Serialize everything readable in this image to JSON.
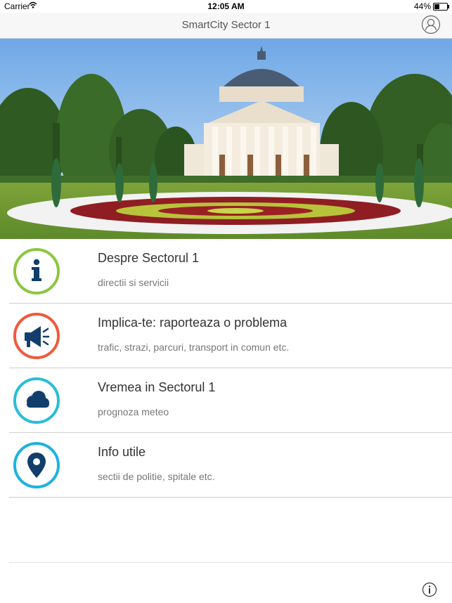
{
  "status_bar": {
    "carrier": "Carrier",
    "time": "12:05 AM",
    "battery_percent": "44%",
    "battery_level": 0.44
  },
  "nav": {
    "title": "SmartCity Sector 1",
    "right_icon": "user-profile-icon"
  },
  "hero": {
    "image": "Romanian Athenaeum with flower garden"
  },
  "menu": {
    "items": [
      {
        "title": "Despre Sectorul 1",
        "subtitle": "directii si servicii",
        "icon": "info-icon",
        "ring_color": "#8dc63f"
      },
      {
        "title": "Implica-te: raporteaza o problema",
        "subtitle": "trafic, strazi, parcuri, transport in comun etc.",
        "icon": "megaphone-icon",
        "ring_color": "#ef5a3c"
      },
      {
        "title": "Vremea in Sectorul 1",
        "subtitle": "prognoza meteo",
        "icon": "cloud-icon",
        "ring_color": "#2bbcd9"
      },
      {
        "title": "Info utile",
        "subtitle": "sectii de politie, spitale etc.",
        "icon": "location-pin-icon",
        "ring_color": "#1fb1e0"
      }
    ]
  },
  "footer": {
    "icon": "info-circle-icon"
  },
  "colors": {
    "icon_fill": "#123e6b",
    "nav_background": "#f7f7f7"
  }
}
